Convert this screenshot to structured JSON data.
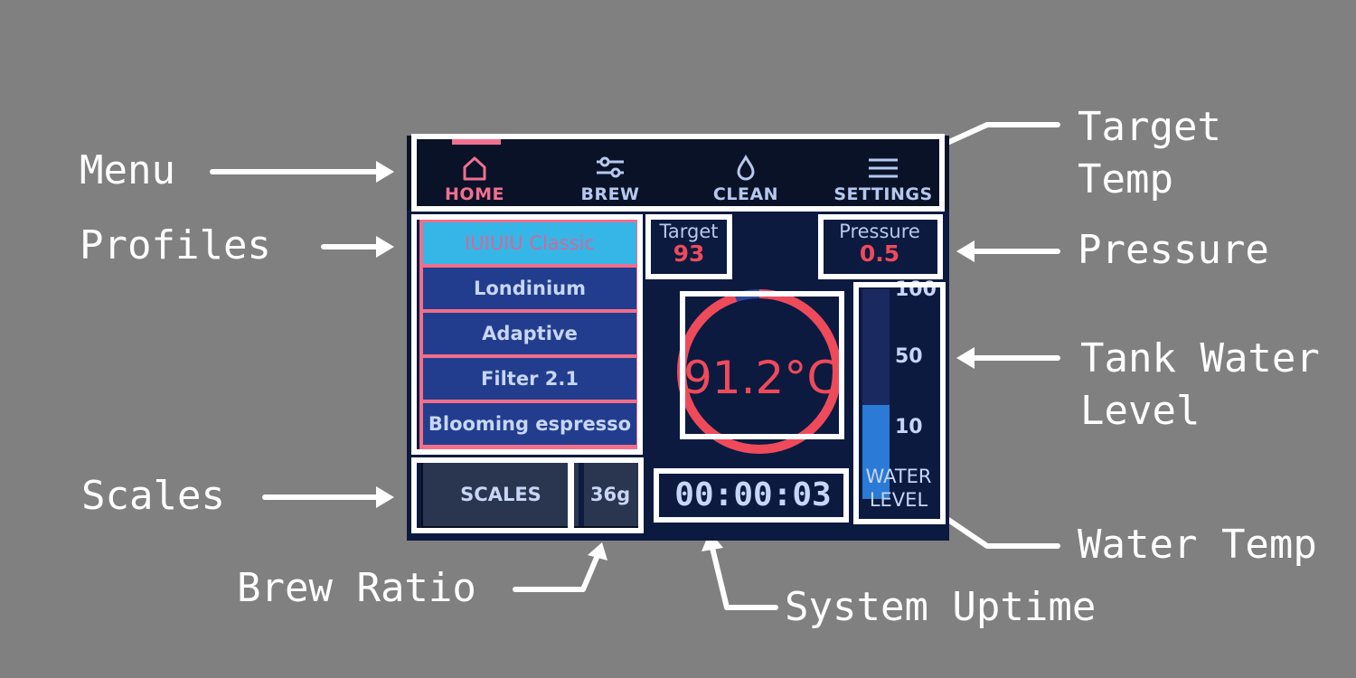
{
  "menu": {
    "tabs": [
      {
        "label": "HOME",
        "icon": "home-icon",
        "active": true
      },
      {
        "label": "BREW",
        "icon": "sliders-icon",
        "active": false
      },
      {
        "label": "CLEAN",
        "icon": "droplet-icon",
        "active": false
      },
      {
        "label": "SETTINGS",
        "icon": "menu-lines-icon",
        "active": false
      }
    ]
  },
  "profiles": [
    {
      "label": "IUIUIU Classic",
      "selected": true
    },
    {
      "label": "Londinium",
      "selected": false
    },
    {
      "label": "Adaptive",
      "selected": false
    },
    {
      "label": "Filter 2.1",
      "selected": false
    },
    {
      "label": "Blooming espresso",
      "selected": false
    }
  ],
  "scales": {
    "label": "SCALES",
    "brew_ratio": "36g"
  },
  "target": {
    "label": "Target",
    "value": "93"
  },
  "pressure": {
    "label": "Pressure",
    "value": "0.5"
  },
  "water_temp": {
    "value": "91.2°C",
    "dial_fraction": 0.95
  },
  "uptime": "00:00:03",
  "tank": {
    "ticks": [
      "100",
      "50",
      "10"
    ],
    "label_line1": "WATER",
    "label_line2": "LEVEL",
    "level_percent": 45
  },
  "callouts": {
    "menu": "Menu",
    "profiles": "Profiles",
    "scales": "Scales",
    "brew_ratio": "Brew Ratio",
    "target_temp": "Target\nTemp",
    "pressure": "Pressure",
    "tank_water_level": "Tank Water\nLevel",
    "water_temp": "Water Temp",
    "system_uptime": "System Uptime"
  },
  "colors": {
    "background": "#808080",
    "screen": "#0c1a40",
    "accent_pink": "#f07090",
    "value_red": "#ef4a5a",
    "selected_profile": "#36b6e6",
    "tank_fill": "#2a7ad6"
  }
}
